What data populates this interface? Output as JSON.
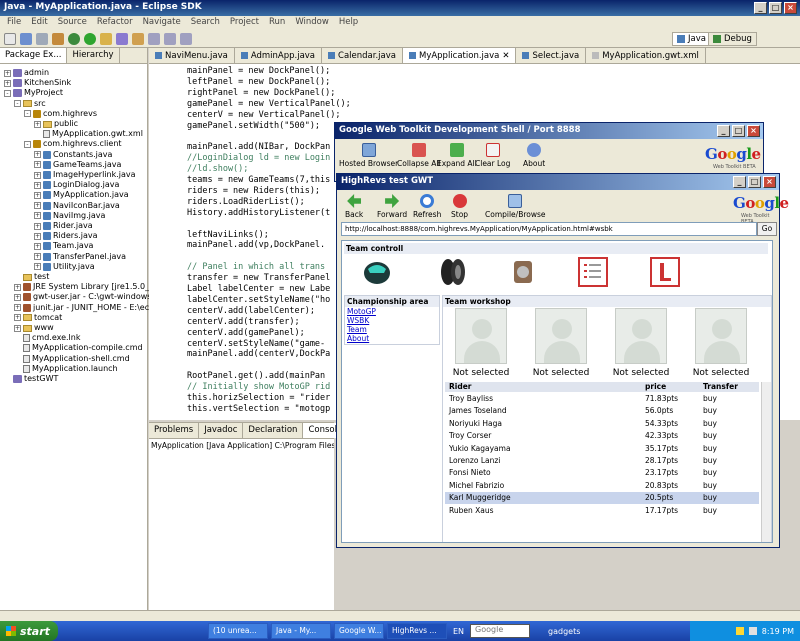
{
  "eclipse": {
    "title": "Java - MyApplication.java - Eclipse SDK",
    "menu": [
      "File",
      "Edit",
      "Source",
      "Refactor",
      "Navigate",
      "Search",
      "Project",
      "Run",
      "Window",
      "Help"
    ],
    "perspectives": [
      "Java",
      "Debug"
    ]
  },
  "package_explorer": {
    "tabs": [
      "Package Ex...",
      "Hierarchy"
    ],
    "tree": [
      {
        "label": "admin",
        "icon": "project-icon",
        "indent": 0,
        "twist": "+"
      },
      {
        "label": "KitchenSink",
        "icon": "project-icon",
        "indent": 0,
        "twist": "+"
      },
      {
        "label": "MyProject",
        "icon": "project-icon",
        "indent": 0,
        "twist": "-"
      },
      {
        "label": "src",
        "icon": "folder-icon",
        "indent": 1,
        "twist": "-"
      },
      {
        "label": "com.highrevs",
        "icon": "package-icon",
        "indent": 2,
        "twist": "-"
      },
      {
        "label": "public",
        "icon": "folder-icon",
        "indent": 3,
        "twist": "+"
      },
      {
        "label": "MyApplication.gwt.xml",
        "icon": "file-icon",
        "indent": 3,
        "twist": ""
      },
      {
        "label": "com.highrevs.client",
        "icon": "package-icon",
        "indent": 2,
        "twist": "-"
      },
      {
        "label": "Constants.java",
        "icon": "java-icon",
        "indent": 3,
        "twist": "+"
      },
      {
        "label": "GameTeams.java",
        "icon": "java-icon",
        "indent": 3,
        "twist": "+"
      },
      {
        "label": "ImageHyperlink.java",
        "icon": "java-icon",
        "indent": 3,
        "twist": "+"
      },
      {
        "label": "LoginDialog.java",
        "icon": "java-icon",
        "indent": 3,
        "twist": "+"
      },
      {
        "label": "MyApplication.java",
        "icon": "java-icon",
        "indent": 3,
        "twist": "+"
      },
      {
        "label": "NaviIconBar.java",
        "icon": "java-icon",
        "indent": 3,
        "twist": "+"
      },
      {
        "label": "NaviImg.java",
        "icon": "java-icon",
        "indent": 3,
        "twist": "+"
      },
      {
        "label": "Rider.java",
        "icon": "java-icon",
        "indent": 3,
        "twist": "+"
      },
      {
        "label": "Riders.java",
        "icon": "java-icon",
        "indent": 3,
        "twist": "+"
      },
      {
        "label": "Team.java",
        "icon": "java-icon",
        "indent": 3,
        "twist": "+"
      },
      {
        "label": "TransferPanel.java",
        "icon": "java-icon",
        "indent": 3,
        "twist": "+"
      },
      {
        "label": "Utility.java",
        "icon": "java-icon",
        "indent": 3,
        "twist": "+"
      },
      {
        "label": "test",
        "icon": "folder-icon",
        "indent": 1,
        "twist": ""
      },
      {
        "label": "JRE System Library [jre1.5.0_10]",
        "icon": "jar-icon",
        "indent": 1,
        "twist": "+"
      },
      {
        "label": "gwt-user.jar - C:\\gwt-windows",
        "icon": "jar-icon",
        "indent": 1,
        "twist": "+"
      },
      {
        "label": "junit.jar - JUNIT_HOME - E:\\eclipse",
        "icon": "jar-icon",
        "indent": 1,
        "twist": "+"
      },
      {
        "label": "tomcat",
        "icon": "folder-icon",
        "indent": 1,
        "twist": "+"
      },
      {
        "label": "www",
        "icon": "folder-icon",
        "indent": 1,
        "twist": "+"
      },
      {
        "label": "cmd.exe.lnk",
        "icon": "file-icon",
        "indent": 1,
        "twist": ""
      },
      {
        "label": "MyApplication-compile.cmd",
        "icon": "file-icon",
        "indent": 1,
        "twist": ""
      },
      {
        "label": "MyApplication-shell.cmd",
        "icon": "file-icon",
        "indent": 1,
        "twist": ""
      },
      {
        "label": "MyApplication.launch",
        "icon": "file-icon",
        "indent": 1,
        "twist": ""
      },
      {
        "label": "testGWT",
        "icon": "project-icon",
        "indent": 0,
        "twist": ""
      }
    ]
  },
  "editor": {
    "tabs": [
      "NaviMenu.java",
      "AdminApp.java",
      "Calendar.java",
      "MyApplication.java",
      "Select.java",
      "MyApplication.gwt.xml"
    ],
    "active_tab": "MyApplication.java",
    "lines": [
      "mainPanel = new DockPanel();",
      "leftPanel = new DockPanel();",
      "rightPanel = new DockPanel();",
      "gamePanel = new VerticalPanel();",
      "centerV = new VerticalPanel();",
      "gamePanel.setWidth(\"500\");",
      "",
      "mainPanel.add(NIBar, DockPan",
      "//LoginDialog ld = new Login",
      "//ld.show();",
      "teams = new GameTeams(7,this",
      "riders = new Riders(this);",
      "riders.LoadRiderList();",
      "History.addHistoryListener(t",
      "",
      "leftNaviLinks();",
      "mainPanel.add(vp,DockPanel.",
      "",
      "// Panel in which all trans",
      "transfer = new TransferPanel",
      "Label labelCenter = new Labe",
      "labelCenter.setStyleName(\"ho",
      "centerV.add(labelCenter);",
      "centerV.add(transfer);",
      "centerV.add(gamePanel);",
      "centerV.setStyleName(\"game-",
      "mainPanel.add(centerV,DockPa",
      "",
      "RootPanel.get().add(mainPan",
      "// Initially show MotoGP rid",
      "this.horizSelection = \"rider",
      "this.vertSelection = \"motogp"
    ]
  },
  "console": {
    "tabs": [
      "Problems",
      "Javadoc",
      "Declaration",
      "Console"
    ],
    "text": "MyApplication [Java Application] C:\\Program Files\\Java\\jre"
  },
  "devshell": {
    "title": "Google Web Toolkit Development Shell / Port 8888",
    "tools": [
      "Hosted Browser",
      "Collapse All",
      "Expand All",
      "Clear Log",
      "About"
    ],
    "logo_sub": "Web Toolkit BETA"
  },
  "hrwin": {
    "title": "HighRevs test GWT",
    "tools": [
      "Back",
      "Forward",
      "Refresh",
      "Stop",
      "Compile/Browse"
    ],
    "url": "http://localhost:8888/com.highrevs.MyApplication/MyApplication.html#wsbk",
    "go": "Go",
    "team_control": "Team controll",
    "championship": {
      "heading": "Championship area",
      "links": [
        "MotoGP",
        "WSBK",
        "Team",
        "About"
      ]
    },
    "workshop": {
      "heading": "Team workshop",
      "slots": [
        "Not selected",
        "Not selected",
        "Not selected",
        "Not selected"
      ]
    },
    "table": {
      "headers": [
        "Rider",
        "price",
        "Transfer"
      ],
      "rows": [
        {
          "rider": "Troy Bayliss",
          "price": "71.83pts",
          "transfer": "buy"
        },
        {
          "rider": "James Toseland",
          "price": "56.0pts",
          "transfer": "buy"
        },
        {
          "rider": "Noriyuki Haga",
          "price": "54.33pts",
          "transfer": "buy"
        },
        {
          "rider": "Troy Corser",
          "price": "42.33pts",
          "transfer": "buy"
        },
        {
          "rider": "Yukio Kagayama",
          "price": "35.17pts",
          "transfer": "buy"
        },
        {
          "rider": "Lorenzo Lanzi",
          "price": "28.17pts",
          "transfer": "buy"
        },
        {
          "rider": "Fonsi Nieto",
          "price": "23.17pts",
          "transfer": "buy"
        },
        {
          "rider": "Michel Fabrizio",
          "price": "20.83pts",
          "transfer": "buy"
        },
        {
          "rider": "Karl Muggeridge",
          "price": "20.5pts",
          "transfer": "buy"
        },
        {
          "rider": "Ruben Xaus",
          "price": "17.17pts",
          "transfer": "buy"
        }
      ]
    }
  },
  "taskbar": {
    "start": "start",
    "tasks": [
      "(10 unrea...",
      "Java - My...",
      "Google W...",
      "HighRevs ...",
      "EN"
    ],
    "search": "Google",
    "gadgets": "gadgets",
    "clock": "8:19 PM"
  }
}
